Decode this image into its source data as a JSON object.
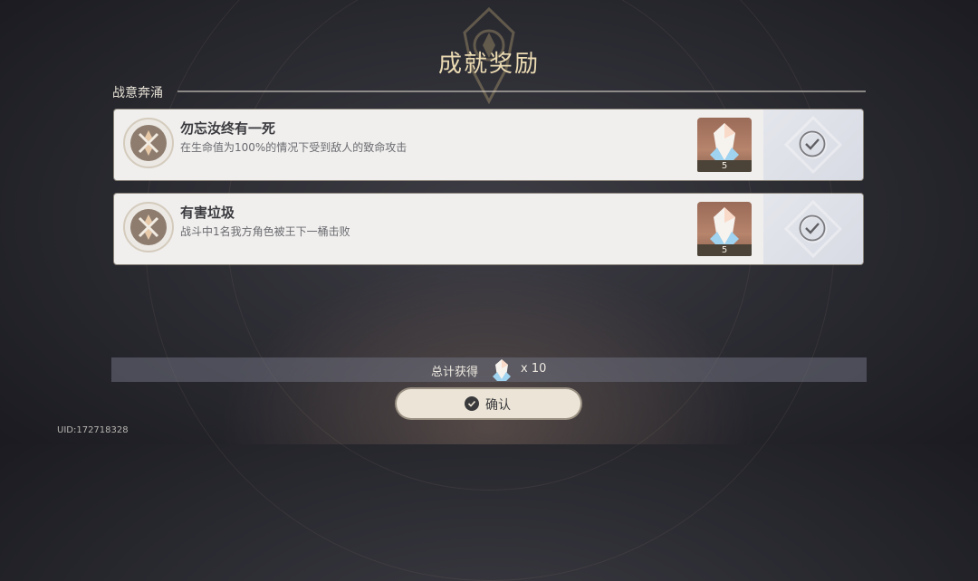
{
  "header": {
    "title": "成就奖励"
  },
  "section": {
    "label": "战意奔涌"
  },
  "achievements": [
    {
      "title": "勿忘汝终有一死",
      "description": "在生命值为100%的情况下受到敌人的致命攻击",
      "reward": {
        "icon": "primogem-icon",
        "count": "5"
      },
      "status": "claimed"
    },
    {
      "title": "有害垃圾",
      "description": "战斗中1名我方角色被王下一桶击败",
      "reward": {
        "icon": "primogem-icon",
        "count": "5"
      },
      "status": "claimed"
    }
  ],
  "total": {
    "label": "总计获得",
    "icon": "primogem-icon",
    "count": "x 10"
  },
  "confirm": {
    "label": "确认",
    "icon": "check-circle-icon"
  },
  "footer": {
    "uid": "UID:172718328"
  },
  "colors": {
    "title": "#ecdcb4",
    "card_bg": "#f0efed",
    "reward_bg": "#b7846c",
    "button_bg": "#ece5d7"
  }
}
